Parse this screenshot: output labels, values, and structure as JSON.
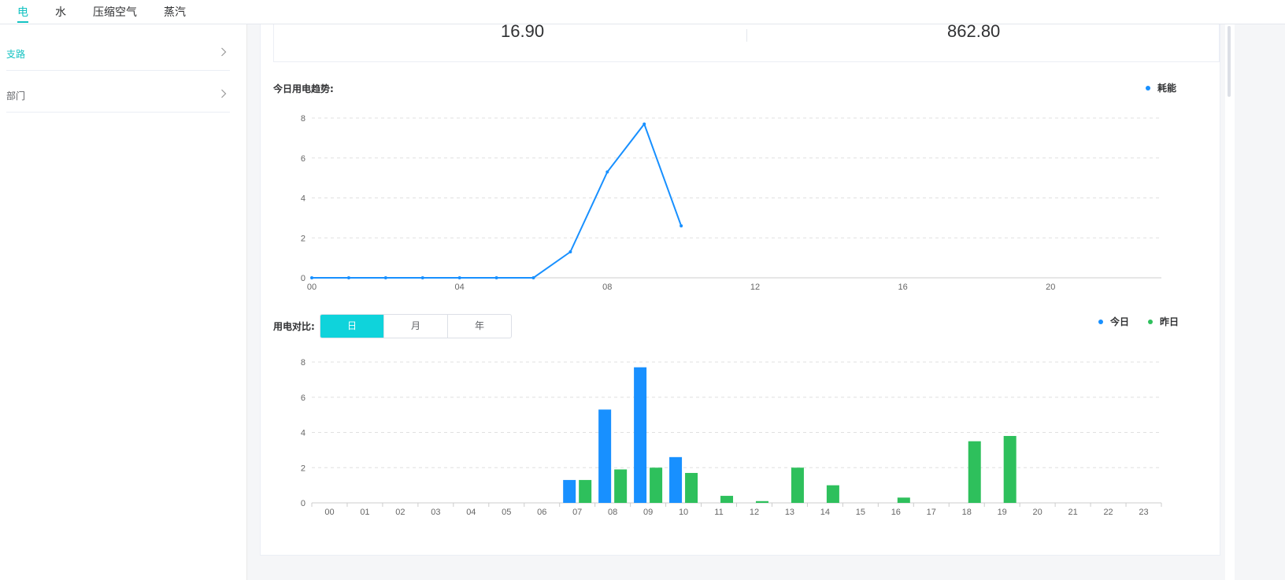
{
  "tabs": [
    {
      "label": "电",
      "active": true
    },
    {
      "label": "水",
      "active": false
    },
    {
      "label": "压缩空气",
      "active": false
    },
    {
      "label": "蒸汽",
      "active": false
    }
  ],
  "sidebar": {
    "items": [
      {
        "label": "支路",
        "active": true,
        "chevron": "chevron-right-icon"
      },
      {
        "label": "部门",
        "active": false,
        "chevron": "chevron-right-icon"
      }
    ]
  },
  "stats": {
    "left_value": "16.90",
    "right_value": "862.80"
  },
  "trend": {
    "title": "今日用电趋势:",
    "legend": "耗能"
  },
  "compare": {
    "title": "用电对比:",
    "segments": [
      {
        "label": "日",
        "active": true
      },
      {
        "label": "月",
        "active": false
      },
      {
        "label": "年",
        "active": false
      }
    ],
    "legend_today": "今日",
    "legend_yesterday": "昨日"
  },
  "colors": {
    "accent": "#13c2c2",
    "segment_active": "#0fd3db",
    "today": "#1890ff",
    "yesterday": "#2ec05c"
  },
  "chart_data": [
    {
      "type": "line",
      "x": [
        "00",
        "01",
        "02",
        "03",
        "04",
        "05",
        "06",
        "07",
        "08",
        "09",
        "10"
      ],
      "x_ticks": [
        "00",
        "04",
        "08",
        "12",
        "16",
        "20"
      ],
      "x_range": [
        0,
        23
      ],
      "series": [
        {
          "name": "耗能",
          "values": [
            0,
            0,
            0,
            0,
            0,
            0,
            0,
            1.3,
            5.3,
            7.7,
            2.6
          ]
        }
      ],
      "ylim": [
        0,
        8
      ],
      "y_ticks": [
        0,
        2,
        4,
        6,
        8
      ],
      "grid": true,
      "legend_position": "top-right"
    },
    {
      "type": "bar",
      "categories": [
        "00",
        "01",
        "02",
        "03",
        "04",
        "05",
        "06",
        "07",
        "08",
        "09",
        "10",
        "11",
        "12",
        "13",
        "14",
        "15",
        "16",
        "17",
        "18",
        "19",
        "20",
        "21",
        "22",
        "23"
      ],
      "series": [
        {
          "name": "今日",
          "values": [
            null,
            null,
            null,
            null,
            null,
            null,
            null,
            1.3,
            5.3,
            7.7,
            2.6,
            null,
            null,
            null,
            null,
            null,
            null,
            null,
            null,
            null,
            null,
            null,
            null,
            null
          ]
        },
        {
          "name": "昨日",
          "values": [
            null,
            null,
            null,
            null,
            null,
            null,
            null,
            1.3,
            1.9,
            2.0,
            1.7,
            0.4,
            0.1,
            2.0,
            1.0,
            null,
            0.3,
            null,
            3.5,
            3.8,
            null,
            null,
            null,
            null
          ]
        }
      ],
      "ylim": [
        0,
        8
      ],
      "y_ticks": [
        0,
        2,
        4,
        6,
        8
      ],
      "grid": true,
      "legend_position": "top-right"
    }
  ]
}
